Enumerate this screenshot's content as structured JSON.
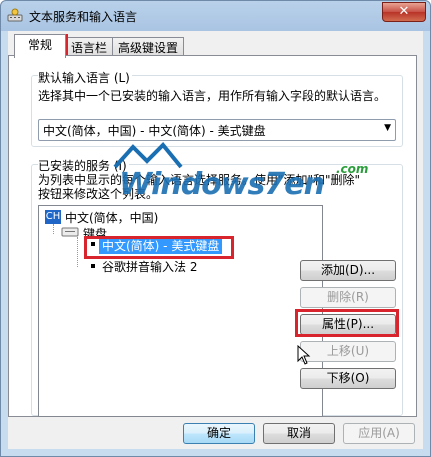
{
  "window": {
    "title": "文本服务和输入语言",
    "close_glyph": "✕"
  },
  "tabs": [
    {
      "label": "常规",
      "active": true
    },
    {
      "label": "语言栏",
      "active": false
    },
    {
      "label": "高级键设置",
      "active": false
    }
  ],
  "default_language": {
    "group_label": "默认输入语言 (L)",
    "description": "选择其中一个已安装的输入语言，用作所有输入字段的默认语言。",
    "selected": "中文(简体，中国) - 中文(简体) - 美式键盘"
  },
  "installed_services": {
    "group_label": "已安装的服务 (I)",
    "description_line1": "为列表中显示的每个输入语言选择服务。使用\"添加\"和\"删除\"",
    "description_line2": "按钮来修改这个列表。",
    "tree": {
      "lang_badge": "CH",
      "language": "中文(简体，中国)",
      "category": "键盘",
      "items": [
        {
          "label": "中文(简体) - 美式键盘",
          "selected": true
        },
        {
          "label": "谷歌拼音输入法 2",
          "selected": false
        }
      ]
    }
  },
  "side_buttons": {
    "add": "添加(D)...",
    "remove": "删除(R)",
    "properties": "属性(P)...",
    "move_up": "上移(U)",
    "move_down": "下移(O)"
  },
  "footer": {
    "ok": "确定",
    "cancel": "取消",
    "apply": "应用(A)"
  },
  "watermark": {
    "text_main": "Windows7en",
    "text_com": ".com"
  },
  "colors": {
    "highlight": "#3399ff",
    "annotation_red": "#d8242c",
    "watermark_blue": "#1a6fb3",
    "watermark_green": "#2a9d3b"
  }
}
